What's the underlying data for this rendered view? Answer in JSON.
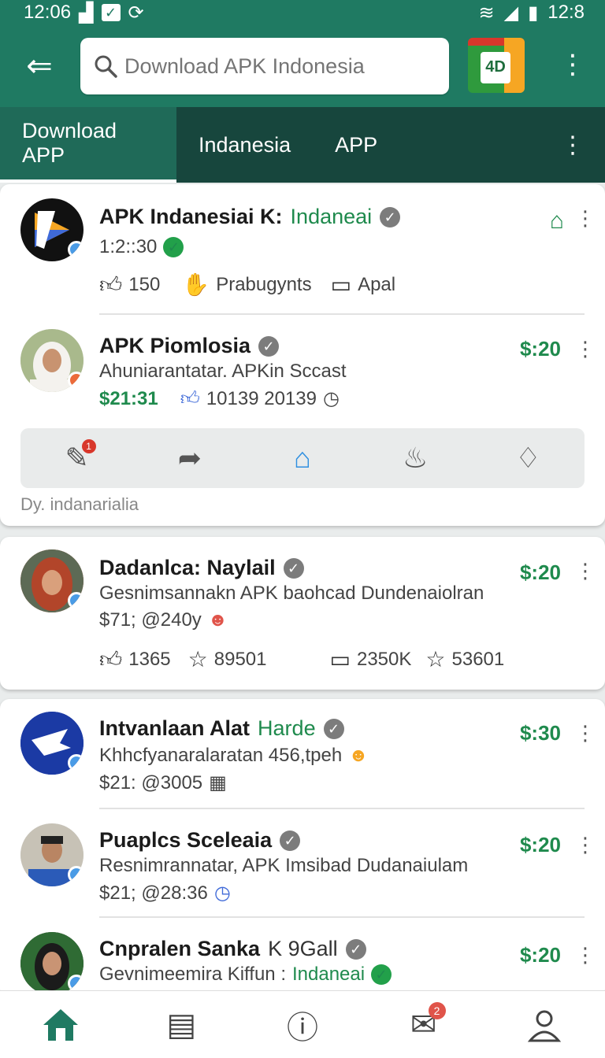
{
  "status_bar": {
    "time": "12:06",
    "clock_right": "12:8"
  },
  "header": {
    "search_placeholder": "Download APK Indonesia",
    "logo_text": "4D"
  },
  "tabs": [
    {
      "label": "Download APP",
      "active": true
    },
    {
      "label": "Indanesia",
      "active": false
    },
    {
      "label": "APP",
      "active": false
    }
  ],
  "posts": [
    {
      "name": "APK Indanesiai K:",
      "tag": "Indaneai",
      "time": "1:2::30",
      "stats": [
        {
          "icon": "thumbs-up-icon",
          "value": "150"
        },
        {
          "icon": "hand-icon",
          "value": "Prabugynts"
        },
        {
          "icon": "comment-icon",
          "value": "Apal"
        }
      ]
    },
    {
      "name": "APK Piomlosia",
      "subtitle": "Ahuniarantatar. APKin Sccast",
      "price_green": "$21:31",
      "meta": "10139 20139",
      "price": "$:20",
      "footnote": "Dy. indanarialia"
    },
    {
      "name": "Dadanlca: Naylail",
      "subtitle": "Gesnimsannakn APK baohcad Dundenaiolran",
      "meta": "$71; @240y",
      "price": "$:20",
      "stats": [
        {
          "icon": "thumbs-up-icon",
          "value": "1365"
        },
        {
          "icon": "star-icon",
          "value": "89501"
        },
        {
          "icon": "comment-icon",
          "value": "2350K"
        },
        {
          "icon": "star-icon",
          "value": "53601"
        }
      ]
    },
    {
      "name": "Intvanlaan Alat",
      "tag": "Harde",
      "subtitle": "Khhcfyanaralaratan 456,tpeh",
      "meta": "$21: @3005",
      "price": "$:30"
    },
    {
      "name": "Puaplcs Sceleaia",
      "subtitle": "Resnimrannatar, APK Imsibad Dudanaiulam",
      "meta": "$21; @28:36",
      "price": "$:20"
    },
    {
      "name": "Cnpralen Sanka",
      "tag": "K 9Gall",
      "subtitle": "Gevnimeemira Kiffun :",
      "subtitle_tag": "Indaneai",
      "price": "$:20"
    }
  ],
  "bottom_nav": {
    "messages_badge": "2"
  },
  "colors": {
    "primary": "#1f7a62",
    "tab_bar": "#17463d",
    "accent_green": "#1f8a4d"
  }
}
